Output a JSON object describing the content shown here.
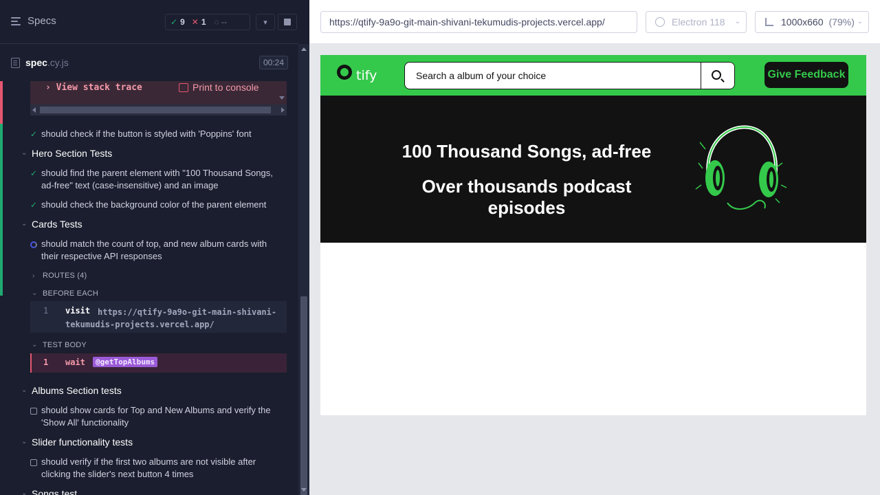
{
  "reporter": {
    "specs_label": "Specs",
    "stats": {
      "passed": "9",
      "failed": "1",
      "pending": "--"
    },
    "spec": {
      "name": "spec",
      "ext": ".cy.js",
      "time": "00:24"
    },
    "error": {
      "stack_trace": "View stack trace",
      "print_to_console": "Print to console"
    },
    "log": [
      {
        "kind": "test-pass",
        "text": "should check if the button is styled with 'Poppins' font"
      },
      {
        "kind": "suite",
        "text": "Hero Section Tests"
      },
      {
        "kind": "test-pass",
        "text": "should find the parent element with \"100 Thousand Songs, ad-free\" text (case-insensitive) and an image"
      },
      {
        "kind": "test-pass",
        "text": "should check the background color of the parent element"
      },
      {
        "kind": "suite",
        "text": "Cards Tests"
      },
      {
        "kind": "test-running",
        "text": "should match the count of top, and new album cards with their respective API responses"
      },
      {
        "kind": "section",
        "text": "ROUTES (4)"
      },
      {
        "kind": "section",
        "text": "BEFORE EACH"
      },
      {
        "kind": "section",
        "text": "TEST BODY"
      },
      {
        "kind": "suite",
        "text": "Albums Section tests"
      },
      {
        "kind": "test-pending",
        "text": "should show cards for Top and New Albums and verify the 'Show All' functionality"
      },
      {
        "kind": "suite",
        "text": "Slider functionality tests"
      },
      {
        "kind": "test-pending",
        "text": "should verify if the first two albums are not visible after clicking the slider's next button 4 times"
      },
      {
        "kind": "suite",
        "text": "Songs test"
      }
    ],
    "before_each": {
      "line": "1",
      "command": "visit",
      "arg": "https://qtify-9a9o-git-main-shivani-tekumudis-projects.vercel.app/"
    },
    "test_body": {
      "line": "1",
      "command": "wait",
      "alias": "@getTopAlbums"
    }
  },
  "preview": {
    "url": "https://qtify-9a9o-git-main-shivani-tekumudis-projects.vercel.app/",
    "browser": "Electron 118",
    "viewport": "1000x660",
    "scale": "(79%)"
  },
  "app": {
    "logo_text": "tify",
    "search_placeholder": "Search a album of your choice",
    "feedback_button": "Give Feedback",
    "hero_line1": "100 Thousand Songs, ad-free",
    "hero_line2": "Over thousands podcast episodes"
  },
  "colors": {
    "brand_green": "#34c94b",
    "hero_bg": "#121212",
    "pass": "#1fa971",
    "fail": "#e45770"
  }
}
